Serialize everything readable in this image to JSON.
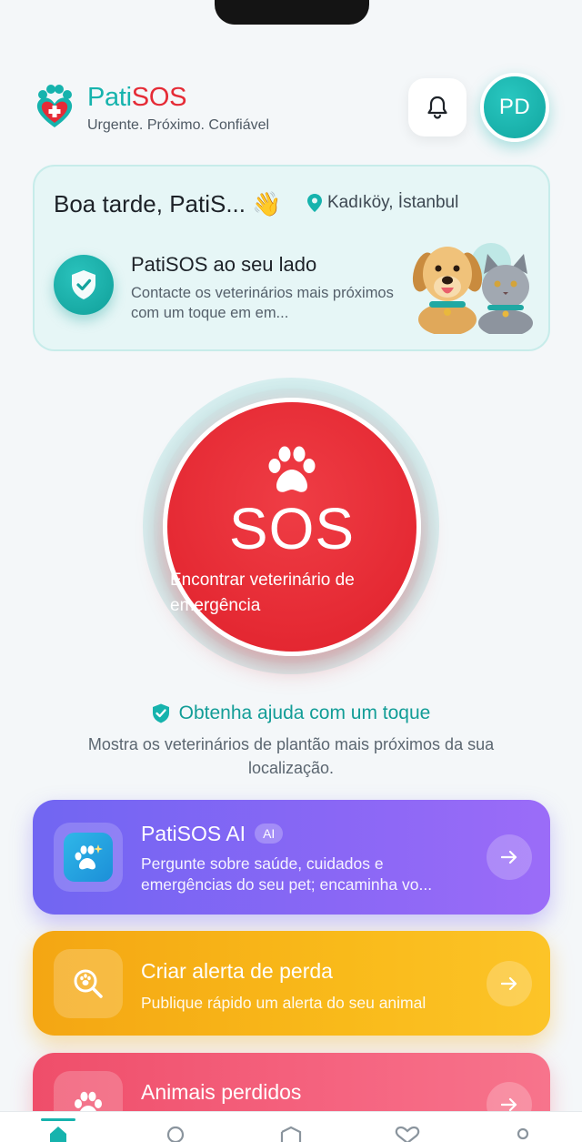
{
  "brand": {
    "name_part1": "Pati",
    "name_part2": "SOS",
    "tagline": "Urgente. Próximo. Confiável"
  },
  "header": {
    "avatar_initials": "PD"
  },
  "greeting": {
    "title": "Boa tarde, PatiS... 👋",
    "location": "Kadıköy, İstanbul",
    "side_title": "PatiSOS ao seu lado",
    "side_desc": "Contacte os veterinários mais próximos com um toque em em..."
  },
  "sos": {
    "label": "SOS",
    "sub": "Encontrar veterinário de emergência",
    "help_title": "Obtenha ajuda com um toque",
    "help_desc": "Mostra os veterinários de plantão mais próximos da sua localização."
  },
  "actions": {
    "ai": {
      "title": "PatiSOS AI",
      "badge": "AI",
      "desc": "Pergunte sobre saúde, cuidados e emergências do seu pet; encaminha vo..."
    },
    "lost_alert": {
      "title": "Criar alerta de perda",
      "desc": "Publique rápido um alerta do seu animal"
    },
    "lost_animals": {
      "title": "Animais perdidos"
    }
  },
  "colors": {
    "teal": "#16b3ad",
    "red": "#e52b36",
    "ai_purple": "#7d66f4",
    "alert_orange": "#f7b015",
    "lost_pink": "#f25a76"
  },
  "icons": {
    "bell": "bell-icon",
    "location": "location-pin-icon",
    "shield": "shield-check-icon",
    "paw": "paw-icon",
    "arrow": "arrow-right-icon",
    "search_paw": "search-paw-icon"
  },
  "tabs": [
    "home-icon",
    "search-icon",
    "shield-icon",
    "heart-icon",
    "profile-icon"
  ]
}
